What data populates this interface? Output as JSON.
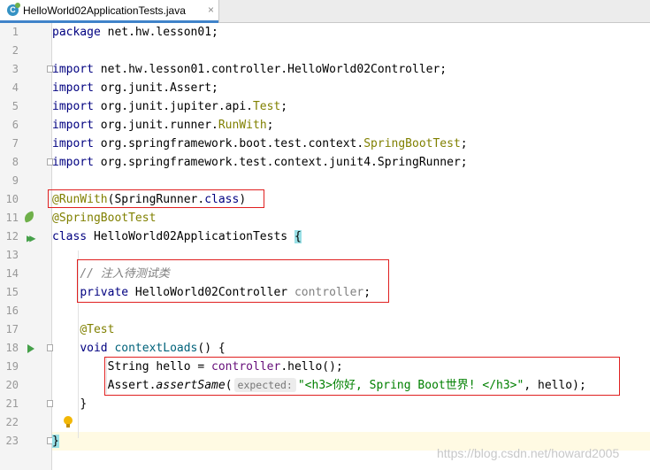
{
  "tab": {
    "filename": "HelloWorld02ApplicationTests.java",
    "icon": "java-class-icon",
    "close": "×"
  },
  "lines": [
    {
      "n": "1"
    },
    {
      "n": "2"
    },
    {
      "n": "3"
    },
    {
      "n": "4"
    },
    {
      "n": "5"
    },
    {
      "n": "6"
    },
    {
      "n": "7"
    },
    {
      "n": "8"
    },
    {
      "n": "9"
    },
    {
      "n": "10"
    },
    {
      "n": "11"
    },
    {
      "n": "12"
    },
    {
      "n": "13"
    },
    {
      "n": "14"
    },
    {
      "n": "15"
    },
    {
      "n": "16"
    },
    {
      "n": "17"
    },
    {
      "n": "18"
    },
    {
      "n": "19"
    },
    {
      "n": "20"
    },
    {
      "n": "21"
    },
    {
      "n": "22"
    },
    {
      "n": "23"
    }
  ],
  "code": {
    "l1": {
      "kw": "package",
      "rest": " net.hw.lesson01;"
    },
    "l3": {
      "kw": "import",
      "rest": " net.hw.lesson01.controller.HelloWorld02Controller;"
    },
    "l4": {
      "kw": "import",
      "rest": " org.junit.Assert;"
    },
    "l5": {
      "kw": "import",
      "pre": " org.junit.jupiter.api.",
      "ann": "Test",
      "post": ";"
    },
    "l6": {
      "kw": "import",
      "pre": " org.junit.runner.",
      "ann": "RunWith",
      "post": ";"
    },
    "l7": {
      "kw": "import",
      "pre": " org.springframework.boot.test.context.",
      "ann": "SpringBootTest",
      "post": ";"
    },
    "l8": {
      "kw": "import",
      "rest": " org.springframework.test.context.junit4.SpringRunner;"
    },
    "l10": {
      "ann": "@RunWith",
      "pre": "(SpringRunner.",
      "kw": "class",
      "post": ")"
    },
    "l11": {
      "ann": "@SpringBootTest"
    },
    "l12": {
      "kw": "class",
      "name": " HelloWorld02ApplicationTests ",
      "brace": "{"
    },
    "l14": {
      "cmt": "// 注入待测试类"
    },
    "l15": {
      "kw": "private",
      "type": " HelloWorld02Controller ",
      "var": "controller",
      "post": ";"
    },
    "l17": {
      "ann": "@Test"
    },
    "l18": {
      "kw": "void",
      "method": " contextLoads",
      "post": "() {"
    },
    "l19": {
      "pre": "String hello = ",
      "fld": "controller",
      "post": ".hello();"
    },
    "l20": {
      "pre": "Assert.",
      "method": "assertSame",
      "open": "(",
      "hint": "expected:",
      "str": "\"<h3>你好, Spring Boot世界! </h3>\"",
      "post": ", hello);"
    },
    "l21": {
      "text": "}"
    },
    "l23": {
      "text": "}"
    }
  },
  "watermark": "https://blog.csdn.net/howard2005"
}
